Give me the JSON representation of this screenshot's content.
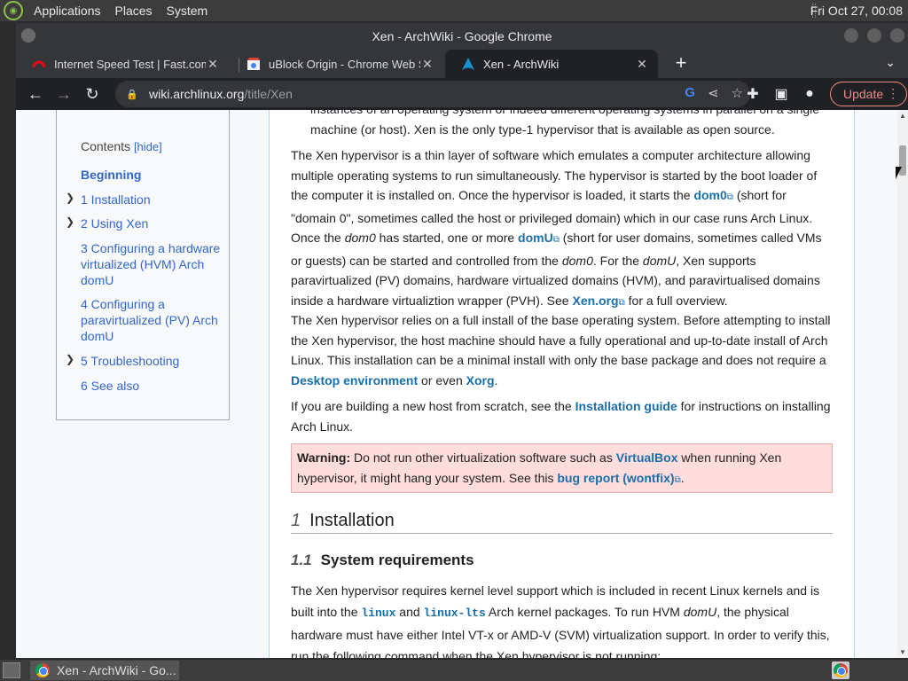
{
  "panel": {
    "menus": [
      "Applications",
      "Places",
      "System"
    ],
    "clock": "Fri Oct 27, 00:08"
  },
  "window": {
    "title": "Xen - ArchWiki - Google Chrome"
  },
  "tabs": [
    {
      "title": "Internet Speed Test | Fast.com",
      "favicon": "fast-com-icon"
    },
    {
      "title": "uBlock Origin - Chrome Web S",
      "favicon": "chrome-web-store-icon"
    },
    {
      "title": "Xen - ArchWiki",
      "favicon": "archlinux-icon"
    }
  ],
  "toolbar": {
    "url_host": "wiki.archlinux.org",
    "url_path": "/title/Xen",
    "update_label": "Update"
  },
  "toc": {
    "title": "Contents",
    "hide": "[hide]",
    "items": [
      {
        "label": "Beginning"
      },
      {
        "label": "1  Installation"
      },
      {
        "label": "2  Using Xen"
      },
      {
        "label": "3  Configuring a hardware virtualized (HVM) Arch domU"
      },
      {
        "label": "4  Configuring a paravirtualized (PV) Arch domU"
      },
      {
        "label": "5  Troubleshooting"
      },
      {
        "label": "6  See also"
      }
    ]
  },
  "content": {
    "intro_tail": "instances of an operating system or indeed different operating systems in parallel on a single machine (or host). Xen is the only type-1 hypervisor that is available as open source.",
    "p1": {
      "a": "The Xen hypervisor is a thin layer of software which emulates a computer architecture allowing multiple operating systems to run simultaneously. The hypervisor is started by the boot loader of the computer it is installed on. Once the hypervisor is loaded, it starts the ",
      "link1": "dom0",
      "b": " (short for \"domain 0\", sometimes called the host or privileged domain) which in our case runs Arch Linux. Once the ",
      "i1": "dom0",
      "c": " has started, one or more ",
      "link2": "domU",
      "d": " (short for user domains, sometimes called VMs or guests) can be started and controlled from the ",
      "i2": "dom0",
      "e": ". For the ",
      "i3": "domU",
      "f": ", Xen supports paravirtualized (PV) domains, hardware virtualized domains (HVM), and paravirtualised domains inside a hardware virtualiztion wrapper (PVH). See ",
      "link3": "Xen.org",
      "g": " for a full overview."
    },
    "p2": {
      "a": "The Xen hypervisor relies on a full install of the base operating system. Before attempting to install the Xen hypervisor, the host machine should have a fully operational and up-to-date install of Arch Linux. This installation can be a minimal install with only the base package and does not require a ",
      "link1": "Desktop environment",
      "b": " or even ",
      "link2": "Xorg",
      "c": "."
    },
    "p3": {
      "a": "If you are building a new host from scratch, see the ",
      "link1": "Installation guide",
      "b": " for instructions on installing Arch Linux."
    },
    "warning": {
      "label": "Warning:",
      "a": " Do not run other virtualization software such as ",
      "link1": "VirtualBox",
      "b": " when running Xen hypervisor, it might hang your system. See this ",
      "link2": "bug report (wontfix)",
      "c": "."
    },
    "h2": {
      "num": "1",
      "text": "Installation"
    },
    "h3": {
      "num": "1.1",
      "text": "System requirements"
    },
    "p4": {
      "a": "The Xen hypervisor requires kernel level support which is included in recent Linux kernels and is built into the ",
      "code1": "linux",
      "b": " and ",
      "code2": "linux-lts",
      "c": " Arch kernel packages. To run HVM ",
      "i1": "domU",
      "d": ", the physical hardware must have either Intel VT-x or AMD-V (SVM) virtualization support. In order to verify this, run the following command when the Xen hypervisor is not running:"
    }
  },
  "taskbar": {
    "task_label": "Xen - ArchWiki - Go..."
  }
}
